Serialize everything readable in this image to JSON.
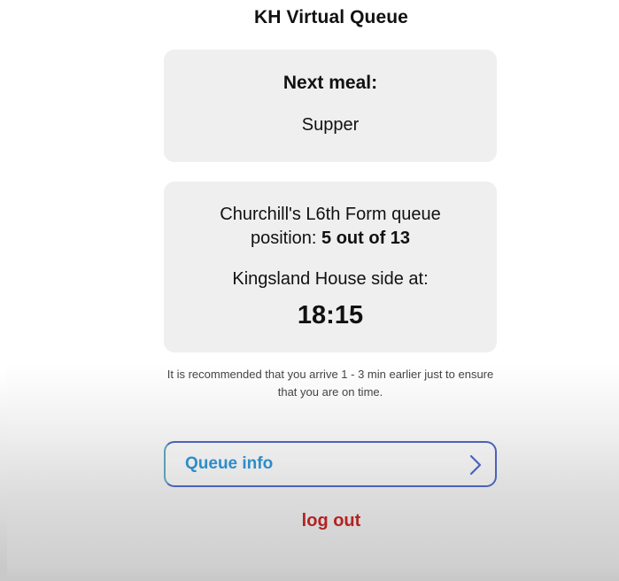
{
  "header": {
    "title": "KH Virtual Queue"
  },
  "meal_card": {
    "heading": "Next meal:",
    "meal": "Supper"
  },
  "queue_card": {
    "line1": "Churchill's L6th Form queue",
    "position_prefix": "position: ",
    "position_value": "5 out of 13",
    "side_label": "Kingsland House side at:",
    "time": "18:15"
  },
  "recommendation": "It is recommended that you arrive 1 - 3 min earlier just to ensure that you are on time.",
  "actions": {
    "queue_info_label": "Queue info",
    "queue_info_icon": "chevron-right-icon",
    "logout_label": "log out"
  },
  "colors": {
    "card_background": "#efefef",
    "queue_info_text": "#2e8cc9",
    "queue_info_border": "#4a63b8",
    "logout_text": "#b32222"
  }
}
